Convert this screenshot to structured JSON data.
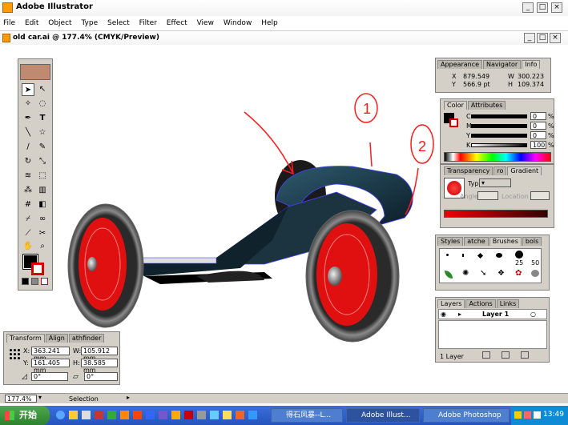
{
  "app": {
    "title": "Adobe Illustrator",
    "accent": "#0b246a"
  },
  "menu": [
    "File",
    "Edit",
    "Object",
    "Type",
    "Select",
    "Filter",
    "Effect",
    "View",
    "Window",
    "Help"
  ],
  "document": {
    "title": "old car.ai @ 177.4% (CMYK/Preview)"
  },
  "annotations": {
    "mark1": "1",
    "mark2": "2"
  },
  "info_panel": {
    "tabs": [
      "Appearance",
      "Navigator",
      "Info"
    ],
    "x_label": "X",
    "x_value": "879.549",
    "y_label": "Y",
    "y_value": "566.9 pt",
    "w_label": "W",
    "w_value": "300.223",
    "h_label": "H",
    "h_value": "109.374"
  },
  "color_panel": {
    "tabs": [
      "Color",
      "Attributes"
    ],
    "channels": [
      {
        "label": "C",
        "value": "0",
        "unit": "%"
      },
      {
        "label": "M",
        "value": "0",
        "unit": "%"
      },
      {
        "label": "Y",
        "value": "0",
        "unit": "%"
      },
      {
        "label": "K",
        "value": "100",
        "unit": "%"
      }
    ]
  },
  "gradient_panel": {
    "tabs": [
      "Transparency",
      "ro",
      "Gradient"
    ],
    "type_label": "Type:",
    "angle_label": "Angle",
    "location_label": "Location"
  },
  "styles_panel": {
    "tabs": [
      "Styles",
      "atche",
      "Brushes",
      "bols"
    ],
    "brush_sizes": [
      "25",
      "50"
    ]
  },
  "layers_panel": {
    "tabs": [
      "Layers",
      "Actions",
      "Links"
    ],
    "layer_name": "Layer 1",
    "count": "1 Layer"
  },
  "transform_panel": {
    "tabs": [
      "Transform",
      "Align",
      "athfinder"
    ],
    "x_label": "X:",
    "x_value": "363.241 mm",
    "y_label": "Y:",
    "y_value": "161.405 mm",
    "w_label": "W:",
    "w_value": "105.912 mm",
    "h_label": "H:",
    "h_value": "38.585 mm",
    "rotate_value": "0°",
    "shear_value": "0°"
  },
  "status": {
    "zoom": "177.4%",
    "tool": "Selection"
  },
  "taskbar": {
    "start": "开始",
    "items": [
      "得石风暴--L...",
      "Adobe Illust...",
      "Adobe Photoshop"
    ],
    "clock": "13:49"
  }
}
